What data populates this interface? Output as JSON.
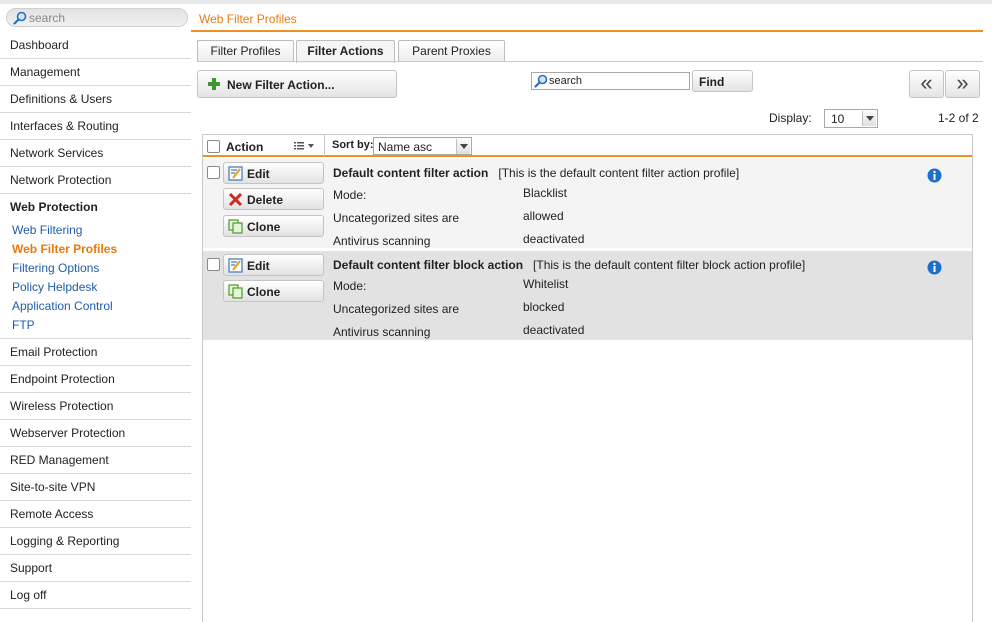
{
  "sidebar": {
    "search_placeholder": "search",
    "items_top": [
      "Dashboard",
      "Management",
      "Definitions & Users",
      "Interfaces & Routing",
      "Network Services",
      "Network Protection"
    ],
    "group": {
      "label": "Web Protection",
      "children": [
        "Web Filtering",
        "Web Filter Profiles",
        "Filtering Options",
        "Policy Helpdesk",
        "Application Control",
        "FTP"
      ],
      "current": "Web Filter Profiles"
    },
    "items_bottom": [
      "Email Protection",
      "Endpoint Protection",
      "Wireless Protection",
      "Webserver Protection",
      "RED Management",
      "Site-to-site VPN",
      "Remote Access",
      "Logging & Reporting",
      "Support",
      "Log off"
    ]
  },
  "page": {
    "title": "Web Filter Profiles"
  },
  "tabs": [
    {
      "label": "Filter Profiles",
      "active": false
    },
    {
      "label": "Filter Actions",
      "active": true
    },
    {
      "label": "Parent Proxies",
      "active": false
    }
  ],
  "toolbar": {
    "new_label": "New Filter Action...",
    "search_placeholder": "search",
    "find_label": "Find",
    "prev_label": "«",
    "next_label": "»",
    "display_label": "Display:",
    "display_value": "10",
    "count_label": "1-2 of 2"
  },
  "grid": {
    "action_header": "Action",
    "sort_label": "Sort by:",
    "sort_value": "Name asc",
    "buttons": {
      "edit": "Edit",
      "delete": "Delete",
      "clone": "Clone"
    },
    "rows": [
      {
        "name": "Default content filter action",
        "comment": "[This is the default content filter action profile]",
        "fields": [
          {
            "label": "Mode:",
            "value": "Blacklist"
          },
          {
            "label": "Uncategorized sites are",
            "value": "allowed"
          },
          {
            "label": "Antivirus scanning",
            "value": "deactivated"
          }
        ]
      },
      {
        "name": "Default content filter block action",
        "comment": "[This is the default content filter block action profile]",
        "fields": [
          {
            "label": "Mode:",
            "value": "Whitelist"
          },
          {
            "label": "Uncategorized sites are",
            "value": "blocked"
          },
          {
            "label": "Antivirus scanning",
            "value": "deactivated"
          }
        ]
      }
    ]
  },
  "colors": {
    "accent": "#e8790e",
    "link": "#1f5ea8",
    "row_alt": "#e2e2e2",
    "row": "#f4f4f4"
  },
  "icons": [
    "search-icon",
    "plus-icon",
    "edit-icon",
    "delete-icon",
    "clone-icon",
    "info-icon",
    "columns-icon",
    "chevron-down-icon"
  ]
}
